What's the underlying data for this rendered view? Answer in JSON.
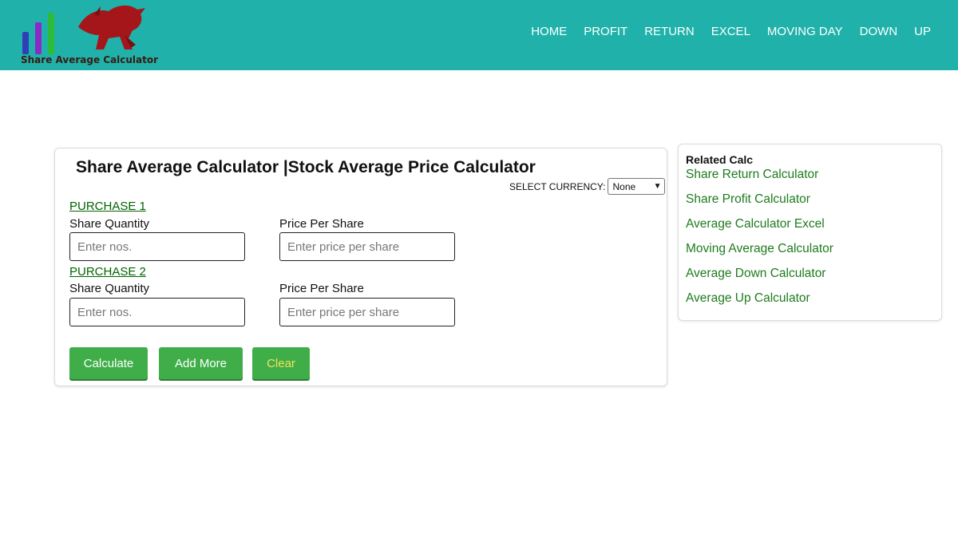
{
  "logo": {
    "text": "Share Average Calculator",
    "bar_colors": [
      "#2e3fb8",
      "#8a2bc9",
      "#2dbb3a"
    ]
  },
  "nav": {
    "items": [
      "HOME",
      "PROFIT",
      "RETURN",
      "EXCEL",
      "MOVING DAY",
      "DOWN",
      "UP"
    ]
  },
  "main": {
    "title": "Share Average Calculator |Stock Average Price Calculator",
    "currency_label": "SELECT CURRENCY:",
    "currency_value": "None",
    "purchases": [
      {
        "heading": "PURCHASE 1",
        "qty_label": "Share Quantity",
        "qty_placeholder": "Enter nos.",
        "price_label": "Price Per Share",
        "price_placeholder": "Enter price per share"
      },
      {
        "heading": "PURCHASE 2",
        "qty_label": "Share Quantity",
        "qty_placeholder": "Enter nos.",
        "price_label": "Price Per Share",
        "price_placeholder": "Enter price per share"
      }
    ],
    "buttons": {
      "calculate": "Calculate",
      "add_more": "Add More",
      "clear": "Clear"
    }
  },
  "sidebar": {
    "title": "Related Calc",
    "links": [
      "Share Return Calculator",
      "Share Profit Calculator",
      "Average Calculator Excel",
      "Moving Average Calculator",
      "Average Down Calculator",
      "Average Up Calculator"
    ]
  },
  "colors": {
    "header": "#20b2aa",
    "button": "#3fae49",
    "clear_text": "#f5e15a",
    "link": "#1e7b1e"
  }
}
